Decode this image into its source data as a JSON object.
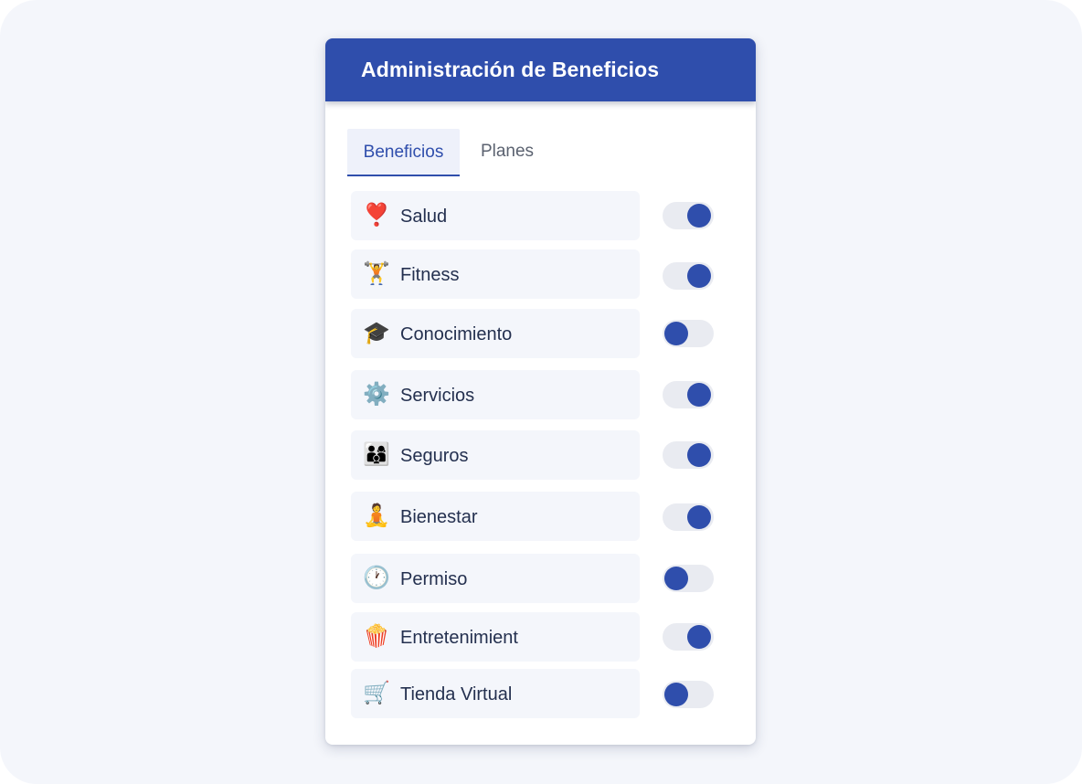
{
  "header": {
    "title": "Administración de Beneficios"
  },
  "tabs": [
    {
      "label": "Beneficios",
      "active": true
    },
    {
      "label": "Planes",
      "active": false
    }
  ],
  "benefits": [
    {
      "icon": "heart-exclamation-icon",
      "glyph": "❣️",
      "label": "Salud",
      "enabled": true
    },
    {
      "icon": "weightlifter-icon",
      "glyph": "🏋️",
      "label": "Fitness",
      "enabled": true
    },
    {
      "icon": "graduation-cap-icon",
      "glyph": "🎓",
      "label": "Conocimiento",
      "enabled": false
    },
    {
      "icon": "gear-icon",
      "glyph": "⚙️",
      "label": "Servicios",
      "enabled": true
    },
    {
      "icon": "family-icon",
      "glyph": "👨‍👩‍👦",
      "label": "Seguros",
      "enabled": true
    },
    {
      "icon": "meditation-icon",
      "glyph": "🧘",
      "label": "Bienestar",
      "enabled": true
    },
    {
      "icon": "clock-icon",
      "glyph": "🕐",
      "label": "Permiso",
      "enabled": false
    },
    {
      "icon": "popcorn-icon",
      "glyph": "🍿",
      "label": "Entretenimient",
      "enabled": true
    },
    {
      "icon": "shopping-cart-icon",
      "glyph": "🛒",
      "label": "Tienda Virtual",
      "enabled": false
    }
  ],
  "colors": {
    "accent": "#2f4eac",
    "page_background": "#f4f6fb",
    "row_background": "#f4f6fb",
    "toggle_track": "#e9ebf1",
    "label_text": "#24304f"
  }
}
